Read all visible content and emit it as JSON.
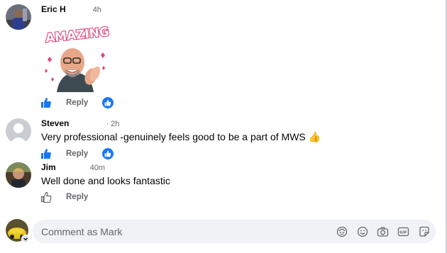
{
  "comments": [
    {
      "author": "Eric H",
      "time": "4h",
      "sticker_text": "AMAZING!",
      "reply_label": "Reply",
      "has_reaction": true
    },
    {
      "author": "Steven",
      "time": "· 2h",
      "text": "Very professional -genuinely feels good to be a part of MWS 👍",
      "reply_label": "Reply",
      "has_reaction": true
    },
    {
      "author": "Jim",
      "time": "40m",
      "text": "Well done and looks fantastic",
      "reply_label": "Reply",
      "has_reaction": false
    }
  ],
  "composer": {
    "placeholder": "Comment as Mark"
  },
  "colors": {
    "accent": "#1877f2",
    "secondary_text": "#65676b",
    "composer_bg": "#f0f2f5"
  },
  "icons": [
    "like-icon",
    "like-reaction-icon",
    "avatar-sticker-icon",
    "emoji-icon",
    "camera-icon",
    "gif-icon",
    "sticker-icon"
  ]
}
